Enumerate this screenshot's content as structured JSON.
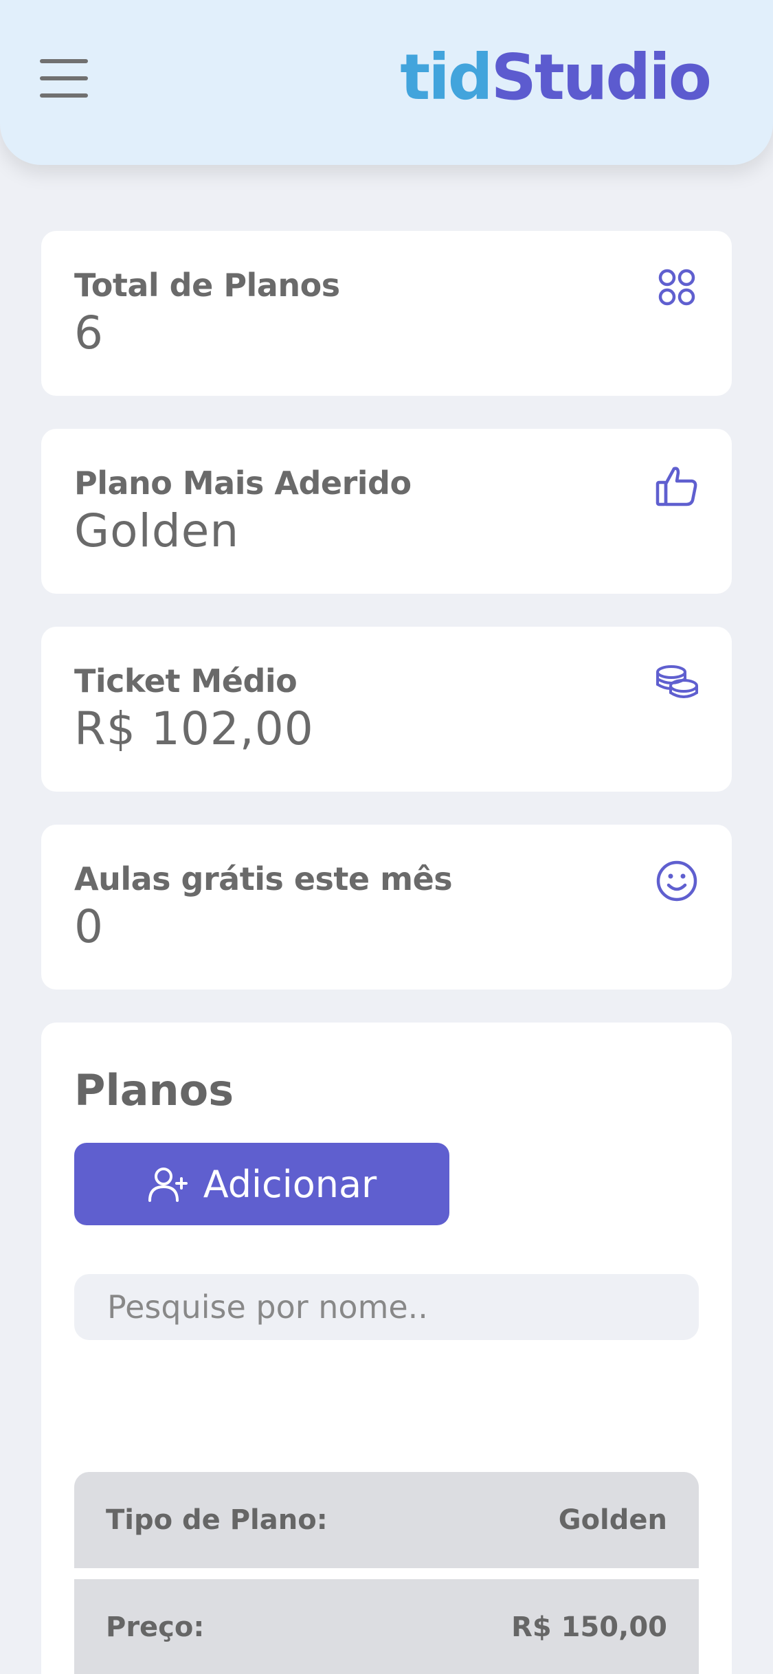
{
  "header": {
    "logo_part1": "tid",
    "logo_part2": "Studio",
    "colors": {
      "logo_tid": "#42a4dc",
      "logo_studio": "#5c5bcf",
      "header_bg": "#e1effb"
    }
  },
  "stats": [
    {
      "label": "Total de Planos",
      "value": "6",
      "icon": "grid-circles-icon"
    },
    {
      "label": "Plano Mais Aderido",
      "value": "Golden",
      "icon": "thumbs-up-icon"
    },
    {
      "label": "Ticket Médio",
      "value": "R$ 102,00",
      "icon": "coins-icon"
    },
    {
      "label": "Aulas grátis este mês",
      "value": "0",
      "icon": "smile-icon"
    }
  ],
  "plans": {
    "title": "Planos",
    "add_label": "Adicionar",
    "search_placeholder": "Pesquise por nome..",
    "rows": [
      {
        "label": "Tipo de Plano:",
        "value": "Golden"
      },
      {
        "label": "Preço:",
        "value": "R$ 150,00"
      }
    ]
  },
  "colors": {
    "accent": "#5f5fcf",
    "background": "#eef0f5"
  }
}
